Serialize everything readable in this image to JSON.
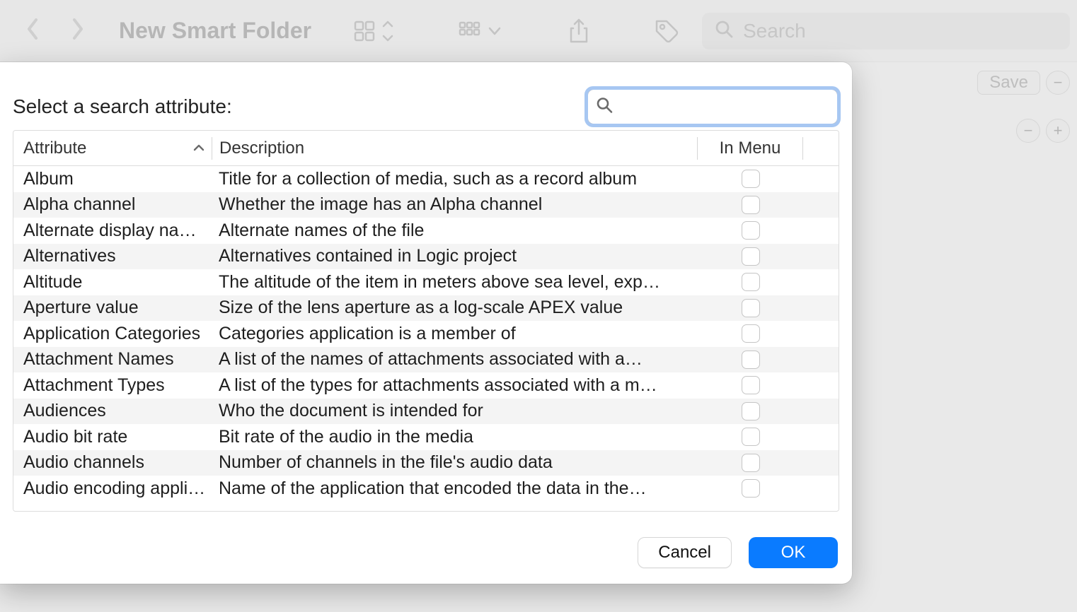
{
  "window": {
    "title": "New Smart Folder",
    "search_placeholder": "Search",
    "save_label": "Save"
  },
  "sheet": {
    "title": "Select a search attribute:",
    "search_value": "",
    "columns": {
      "attr": "Attribute",
      "desc": "Description",
      "menu": "In Menu"
    },
    "cancel_label": "Cancel",
    "ok_label": "OK"
  },
  "attributes": [
    {
      "name": "Album",
      "desc": "Title for a collection of media, such as a record album",
      "in_menu": false
    },
    {
      "name": "Alpha channel",
      "desc": "Whether the image has an Alpha channel",
      "in_menu": false
    },
    {
      "name": "Alternate display nam…",
      "desc": "Alternate names of the file",
      "in_menu": false
    },
    {
      "name": "Alternatives",
      "desc": "Alternatives contained in Logic project",
      "in_menu": false
    },
    {
      "name": "Altitude",
      "desc": "The altitude of the item in meters above sea level, exp…",
      "in_menu": false
    },
    {
      "name": "Aperture value",
      "desc": "Size of the lens aperture as a log-scale APEX value",
      "in_menu": false
    },
    {
      "name": "Application Categories",
      "desc": "Categories application is a member of",
      "in_menu": false
    },
    {
      "name": "Attachment Names",
      "desc": "A list of the names of attachments associated with a…",
      "in_menu": false
    },
    {
      "name": "Attachment Types",
      "desc": "A list of the types for attachments associated with a m…",
      "in_menu": false
    },
    {
      "name": "Audiences",
      "desc": "Who the document is intended for",
      "in_menu": false
    },
    {
      "name": "Audio bit rate",
      "desc": "Bit rate of the audio in the media",
      "in_menu": false
    },
    {
      "name": "Audio channels",
      "desc": "Number of channels in the file's audio data",
      "in_menu": false
    },
    {
      "name": "Audio encoding appli…",
      "desc": "Name of the application that encoded the data in the…",
      "in_menu": false
    }
  ]
}
